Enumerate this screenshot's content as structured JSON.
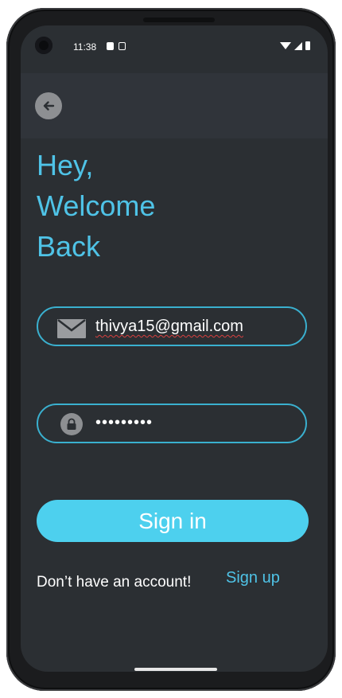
{
  "status_bar": {
    "time": "11:38"
  },
  "header": {
    "back_icon": "arrow-left-icon"
  },
  "welcome": {
    "line1": "Hey,",
    "line2": "Welcome",
    "line3": "Back"
  },
  "form": {
    "email_value": "thivya15@gmail.com",
    "email_icon": "envelope-icon",
    "password_mask": "•••••••••",
    "password_icon": "lock-icon",
    "signin_label": "Sign in"
  },
  "footer": {
    "prompt": "Don’t have an account!",
    "signup_label": "Sign up"
  },
  "colors": {
    "accent": "#4fc3e7",
    "button": "#4dd0ee",
    "background": "#2b2f33",
    "field_border": "#3ab0cf"
  }
}
